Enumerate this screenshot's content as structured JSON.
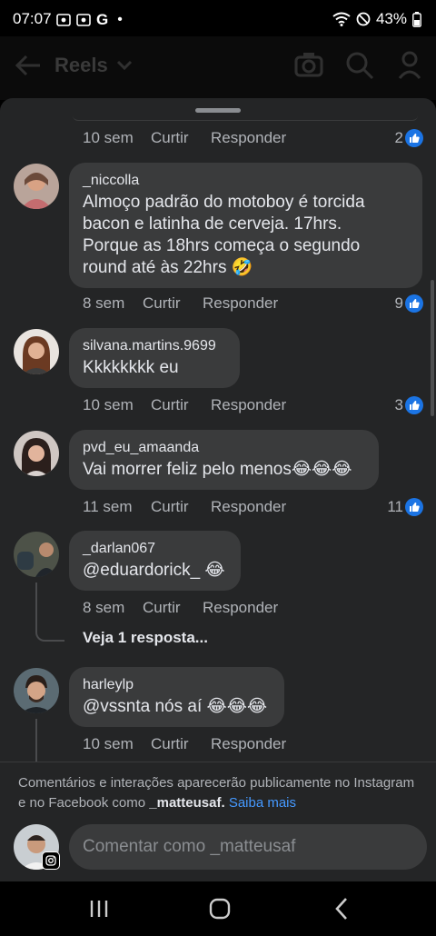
{
  "status": {
    "time": "07:07",
    "g_label": "G",
    "dot": "•",
    "battery": "43%"
  },
  "appbar": {
    "title": "Reels",
    "icons": [
      "back-arrow-icon",
      "chevron-down-icon",
      "camera-icon",
      "search-icon",
      "profile-icon"
    ]
  },
  "comments": [
    {
      "time": "10 sem",
      "like_label": "Curtir",
      "reply_label": "Responder",
      "likes": "2"
    },
    {
      "name": "_niccolla",
      "lines": [
        "Almoço padrão do motoboy é torcida",
        "bacon e latinha de cerveja. 17hrs.",
        "Porque as 18hrs começa o segundo",
        "round até às 22hrs 🤣"
      ],
      "time": "8 sem",
      "like_label": "Curtir",
      "reply_label": "Responder",
      "likes": "9"
    },
    {
      "name": "silvana.martins.9699",
      "text": "Kkkkkkkk eu",
      "time": "10 sem",
      "like_label": "Curtir",
      "reply_label": "Responder",
      "likes": "3"
    },
    {
      "name": "pvd_eu_amaanda",
      "text": "Vai morrer feliz pelo menos😂😂😂",
      "time": "11 sem",
      "like_label": "Curtir",
      "reply_label": "Responder",
      "likes": "11"
    },
    {
      "name": "_darlan067",
      "text": "@eduardorick_ 😂",
      "time": "8 sem",
      "like_label": "Curtir",
      "reply_label": "Responder",
      "replies_link": "Veja 1 resposta..."
    },
    {
      "name": "harleylp",
      "text": "@vssnta  nós aí 😂😂😂",
      "time": "10 sem",
      "like_label": "Curtir",
      "reply_label": "Responder"
    }
  ],
  "footer": {
    "notice_prefix": "Comentários e interações aparecerão publicamente no Instagram e no Facebook como ",
    "notice_user": "_matteusaf.",
    "notice_link": "Saiba mais",
    "input_placeholder": "Comentar como _matteusaf"
  },
  "navbar": {
    "icons": [
      "recent-apps-icon",
      "home-icon",
      "back-icon"
    ]
  },
  "colors": {
    "sheet_bg": "#242526",
    "bubble_bg": "#3a3b3c",
    "like_blue": "#1b74e4",
    "link_blue": "#4599ff"
  }
}
